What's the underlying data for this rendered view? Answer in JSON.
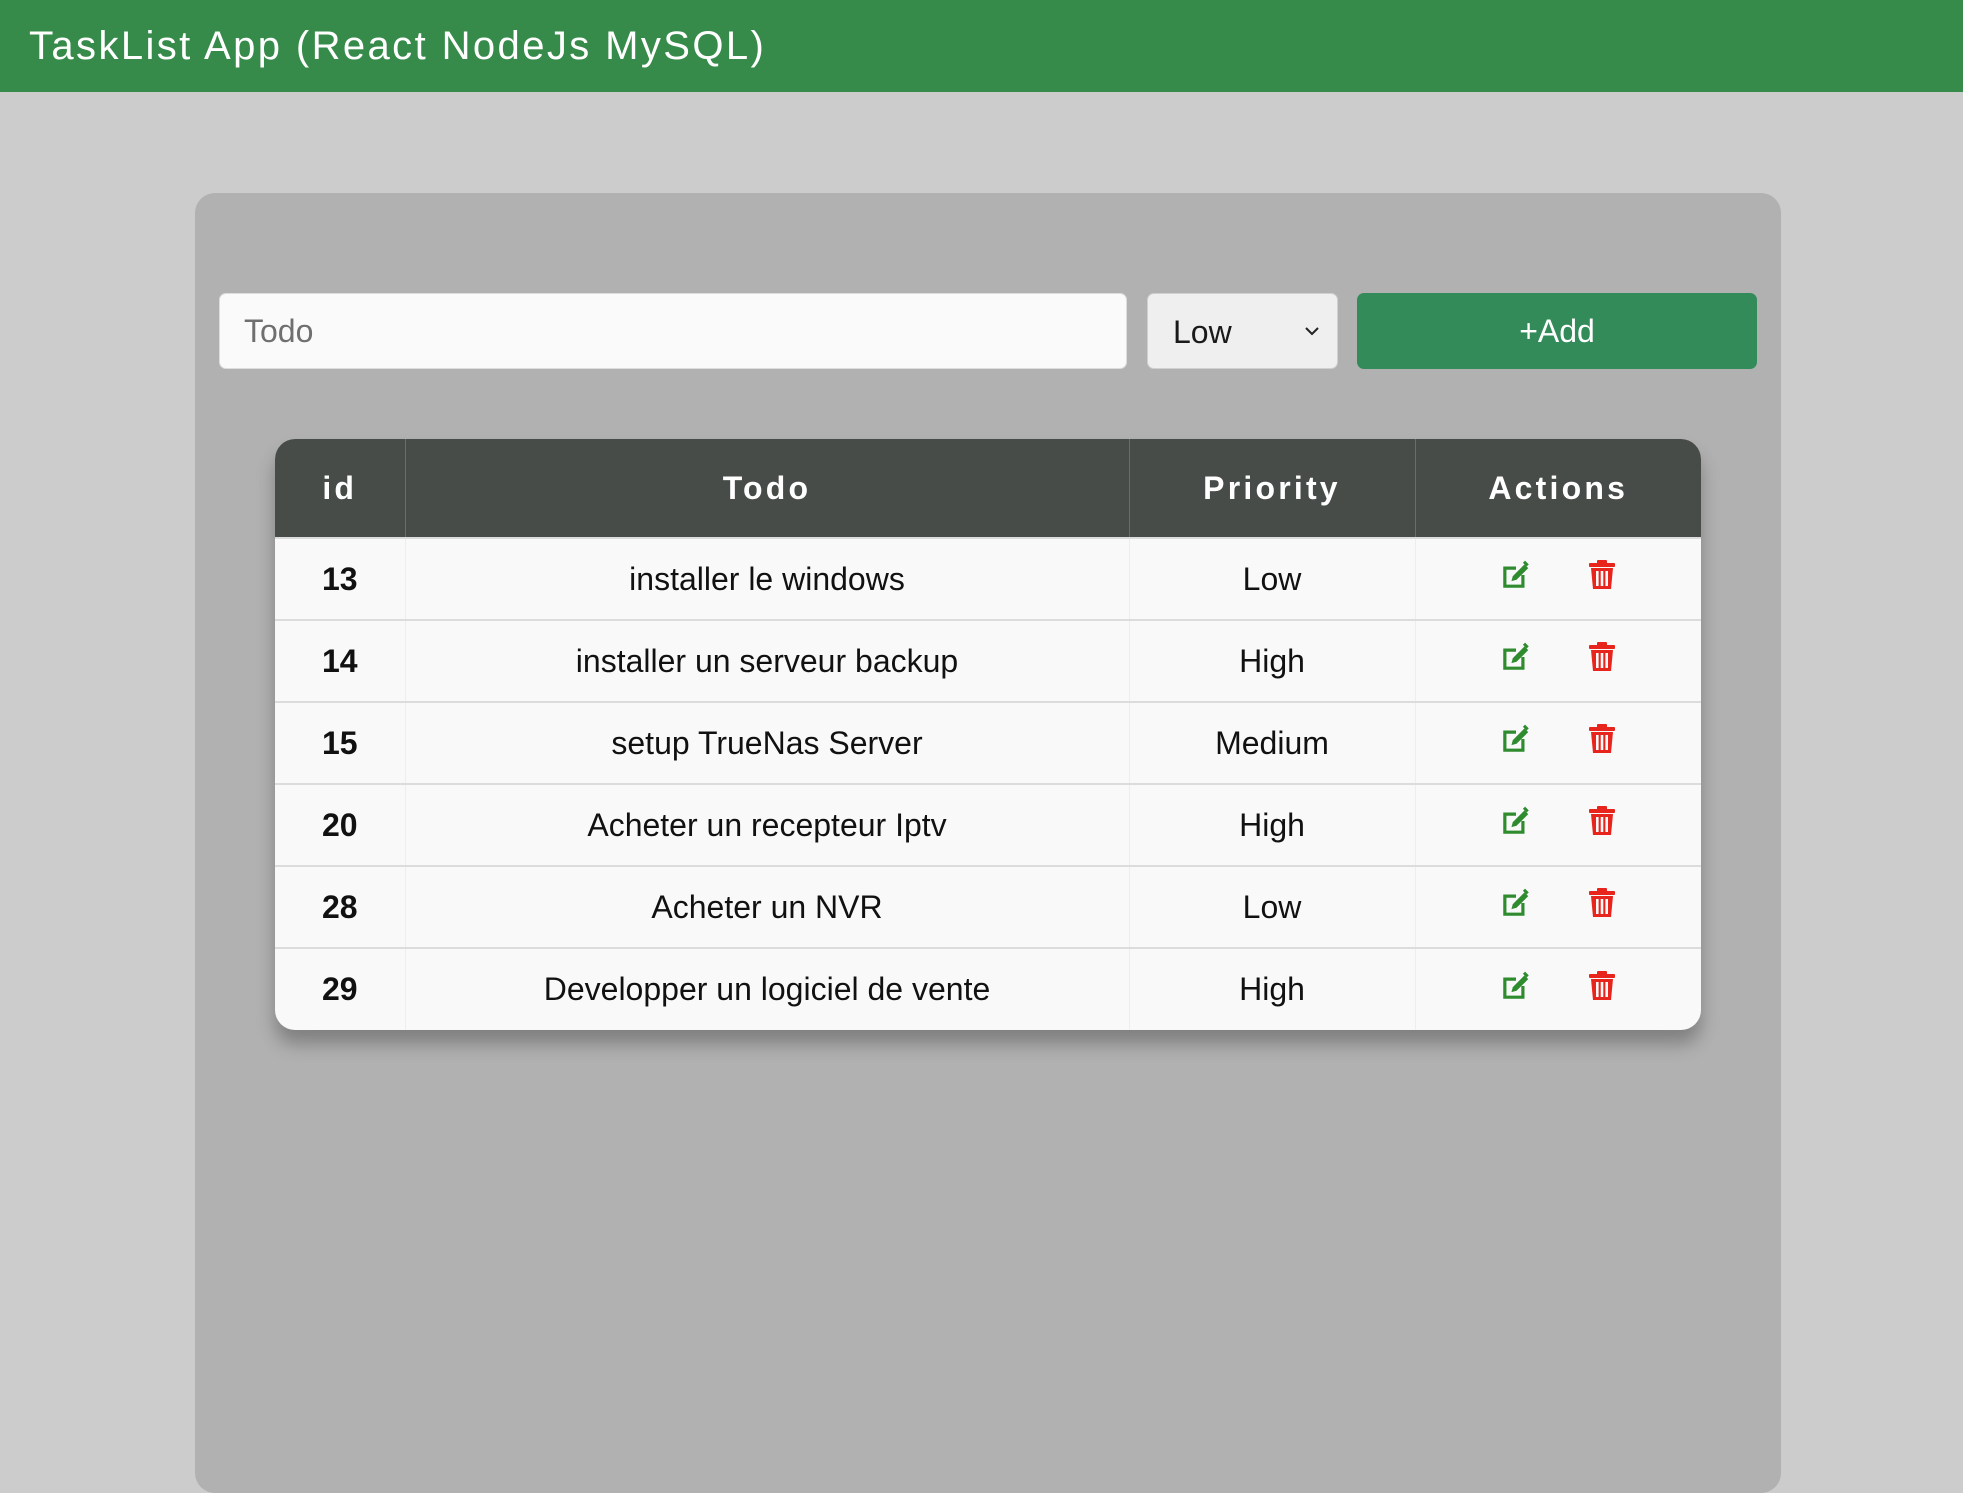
{
  "header": {
    "title": "TaskList App (React NodeJs MySQL)"
  },
  "form": {
    "todo_placeholder": "Todo",
    "todo_value": "",
    "priority_selected": "Low",
    "add_label": "+Add"
  },
  "table": {
    "columns": [
      "id",
      "Todo",
      "Priority",
      "Actions"
    ],
    "rows": [
      {
        "id": "13",
        "todo": "installer le windows",
        "priority": "Low"
      },
      {
        "id": "14",
        "todo": "installer un serveur backup",
        "priority": "High"
      },
      {
        "id": "15",
        "todo": "setup TrueNas Server",
        "priority": "Medium"
      },
      {
        "id": "20",
        "todo": "Acheter un recepteur Iptv",
        "priority": "High"
      },
      {
        "id": "28",
        "todo": "Acheter un NVR",
        "priority": "Low"
      },
      {
        "id": "29",
        "todo": "Developper un logiciel de vente",
        "priority": "High"
      }
    ]
  },
  "icons": {
    "edit": "edit-icon",
    "delete": "trash-icon",
    "dropdown": "chevron-down-icon"
  },
  "colors": {
    "header_bar": "#368b4a",
    "add_button": "#338b5a",
    "table_header": "#474c48",
    "edit_icon": "#2e8b2e",
    "delete_icon": "#e8251c"
  }
}
